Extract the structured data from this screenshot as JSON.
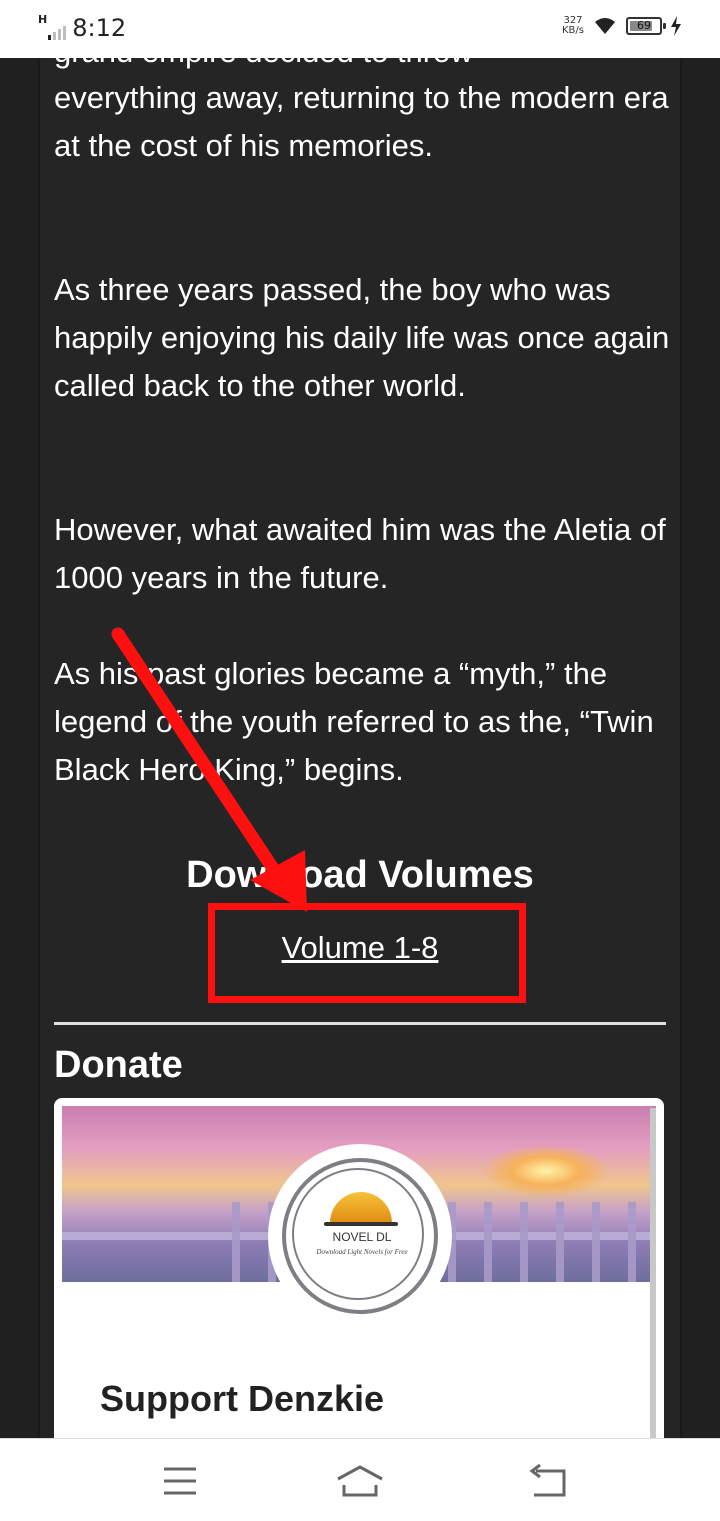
{
  "status_bar": {
    "network_type": "H",
    "time": "8:12",
    "net_speed_value": "327",
    "net_speed_unit": "KB/s",
    "battery_level": "69",
    "battery_fraction": 0.69,
    "icons": [
      "signal-icon",
      "wifi-icon",
      "battery-icon",
      "charging-icon"
    ]
  },
  "article": {
    "partial_line": "grand empire decided to throw",
    "paragraphs": [
      "everything away, returning to the modern era at the cost of his memories.",
      "As three years passed, the boy who was happily enjoying his daily life was once again called back to the other world.",
      "However, what awaited him was the Aletia of 1000 years in the future.",
      "As his past glories became a “myth,” the legend of the youth referred to as the, “Twin Black Hero King,” begins."
    ]
  },
  "downloads": {
    "heading": "Download Volumes",
    "link_label": "Volume 1-8"
  },
  "donate": {
    "heading": "Donate",
    "card_title": "Support Denzkie",
    "logo_title": "NOVEL DL",
    "logo_subtitle": "Download Light Novels for Free"
  },
  "colors": {
    "background": "#202020",
    "annotation": "#ff1010",
    "text": "#ffffff"
  },
  "nav": {
    "icons": [
      "menu-icon",
      "home-icon",
      "back-icon"
    ]
  }
}
